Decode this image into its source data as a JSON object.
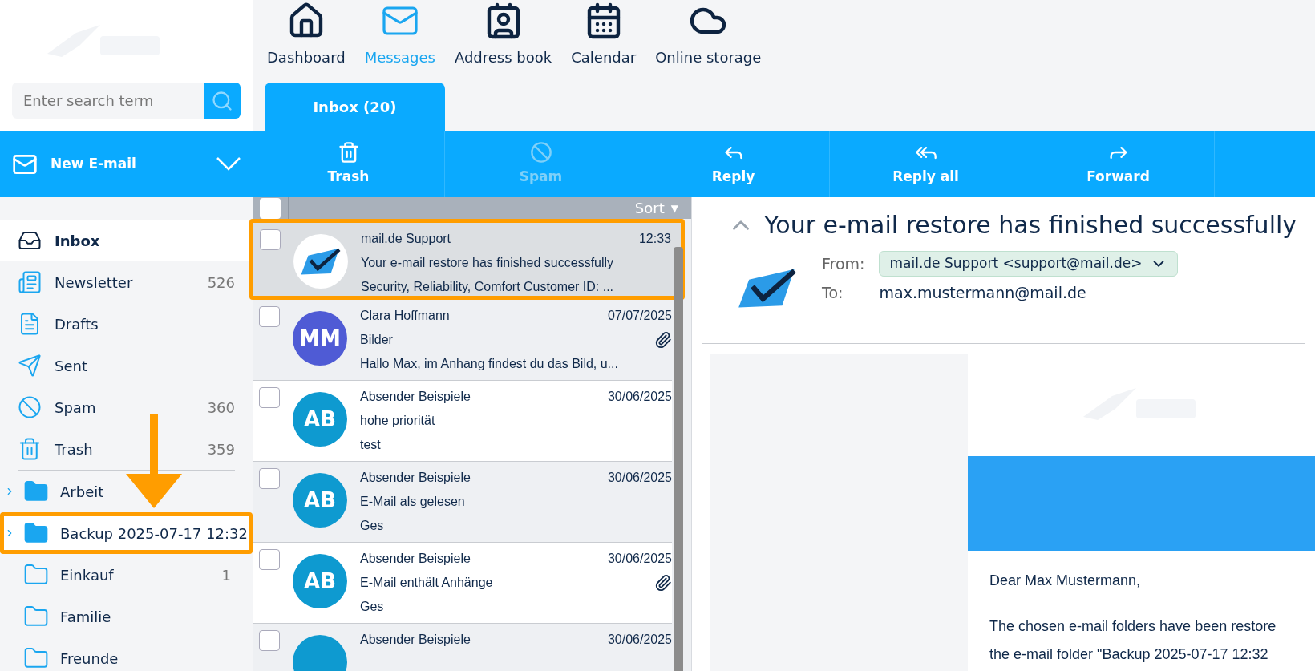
{
  "search": {
    "placeholder": "Enter search term"
  },
  "new_email": {
    "label": "New E-mail"
  },
  "nav": [
    {
      "label": "Dashboard",
      "kind": "home",
      "selected": false
    },
    {
      "label": "Messages",
      "kind": "mail",
      "selected": true
    },
    {
      "label": "Address book",
      "kind": "contact",
      "selected": false
    },
    {
      "label": "Calendar",
      "kind": "calendar",
      "selected": false
    },
    {
      "label": "Online storage",
      "kind": "cloud",
      "selected": false
    }
  ],
  "tabs": [
    {
      "label": "Inbox (20)",
      "selected": true
    }
  ],
  "toolbar": [
    {
      "label": "Trash",
      "kind": "trash",
      "disabled": false
    },
    {
      "label": "Spam",
      "kind": "spam",
      "disabled": true
    },
    {
      "label": "Reply",
      "kind": "reply",
      "disabled": false
    },
    {
      "label": "Reply all",
      "kind": "reply-all",
      "disabled": false
    },
    {
      "label": "Forward",
      "kind": "forward",
      "disabled": false
    }
  ],
  "system_folders": [
    {
      "name": "Inbox",
      "kind": "inbox",
      "selected": true
    },
    {
      "name": "Newsletter",
      "kind": "newsletter",
      "count": "526",
      "selected": false
    },
    {
      "name": "Drafts",
      "kind": "drafts",
      "selected": false
    },
    {
      "name": "Sent",
      "kind": "sent",
      "selected": false
    },
    {
      "name": "Spam",
      "kind": "spam",
      "count": "360",
      "selected": false
    },
    {
      "name": "Trash",
      "kind": "trash",
      "count": "359",
      "selected": false
    }
  ],
  "folders": [
    {
      "name": "Arbeit",
      "has_subfolders": true,
      "highlighted": false
    },
    {
      "name": "Backup 2025-07-17 12:32",
      "has_subfolders": true,
      "highlighted": true
    },
    {
      "name": "Einkauf",
      "count": "1",
      "has_subfolders": false,
      "highlighted": false
    },
    {
      "name": "Familie",
      "has_subfolders": false,
      "highlighted": false
    },
    {
      "name": "Freunde",
      "has_subfolders": false,
      "highlighted": false
    }
  ],
  "list_header": {
    "sort": "Sort",
    "sort_indicator": "▼",
    "all_checked": false
  },
  "messages": [
    {
      "sender": "mail.de Support",
      "time": "12:33",
      "subject": "Your e-mail restore has finished successfully",
      "preview": "Security, Reliability, Comfort Customer ID: ...",
      "avatar": {
        "kind": "logo"
      },
      "attachment": false,
      "selected": true,
      "highlighted": true
    },
    {
      "sender": "Clara Hoffmann",
      "time": "07/07/2025",
      "subject": "Bilder",
      "preview": "Hallo Max, im Anhang findest du das Bild, u...",
      "avatar": {
        "kind": "initials",
        "initials": "MM",
        "color": "#4f5bd5"
      },
      "attachment": true,
      "selected": false,
      "highlighted": false
    },
    {
      "sender": "Absender Beispiele",
      "time": "30/06/2025",
      "subject": "hohe priorität",
      "preview": "test",
      "avatar": {
        "kind": "initials",
        "initials": "AB",
        "color": "#0e9ad0"
      },
      "attachment": false,
      "selected": false,
      "highlighted": false
    },
    {
      "sender": "Absender Beispiele",
      "time": "30/06/2025",
      "subject": "E-Mail als gelesen",
      "preview": "Ges",
      "avatar": {
        "kind": "initials",
        "initials": "AB",
        "color": "#0e9ad0"
      },
      "attachment": false,
      "selected": false,
      "highlighted": false
    },
    {
      "sender": "Absender Beispiele",
      "time": "30/06/2025",
      "subject": "E-Mail enthält Anhänge",
      "preview": "Ges",
      "avatar": {
        "kind": "initials",
        "initials": "AB",
        "color": "#0e9ad0"
      },
      "attachment": true,
      "selected": false,
      "highlighted": false
    },
    {
      "sender": "Absender Beispiele",
      "time": "30/06/2025",
      "avatar": {
        "kind": "initials",
        "color": "#0e9ad0"
      },
      "attachment": false,
      "selected": false,
      "highlighted": false
    }
  ],
  "reader": {
    "title": "Your e-mail restore has finished successfully",
    "from_label": "From:",
    "from": "mail.de Support <support@mail.de>",
    "to_label": "To:",
    "to": "max.mustermann@mail.de",
    "greeting": "Dear Max Mustermann,",
    "body_lines": [
      "The chosen e-mail folders have been restore",
      "the e-mail folder \"Backup 2025-07-17 12:32"
    ]
  }
}
